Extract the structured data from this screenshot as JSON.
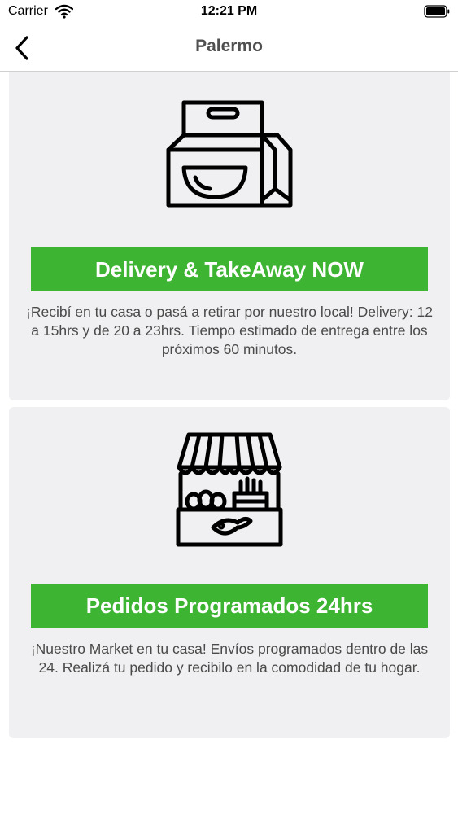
{
  "status_bar": {
    "carrier": "Carrier",
    "time": "12:21 PM"
  },
  "nav": {
    "title": "Palermo",
    "back_icon": "chevron-left-icon"
  },
  "options": [
    {
      "icon": "takeaway-bag-icon",
      "button_label": "Delivery & TakeAway NOW",
      "description": "¡Recibí en tu casa o pasá a retirar por nuestro local! Delivery: 12 a 15hrs y de 20 a 23hrs. Tiempo estimado de entrega entre los próximos 60 minutos."
    },
    {
      "icon": "market-stall-icon",
      "button_label": "Pedidos Programados 24hrs",
      "description": "¡Nuestro Market en tu casa! Envíos programados dentro de las 24. Realizá tu pedido y recibilo en la comodidad de tu hogar."
    }
  ],
  "colors": {
    "accent_green": "#3db432",
    "card_background": "#f0f0f2",
    "description_text": "#4a4a4a",
    "title_text": "#505050"
  }
}
